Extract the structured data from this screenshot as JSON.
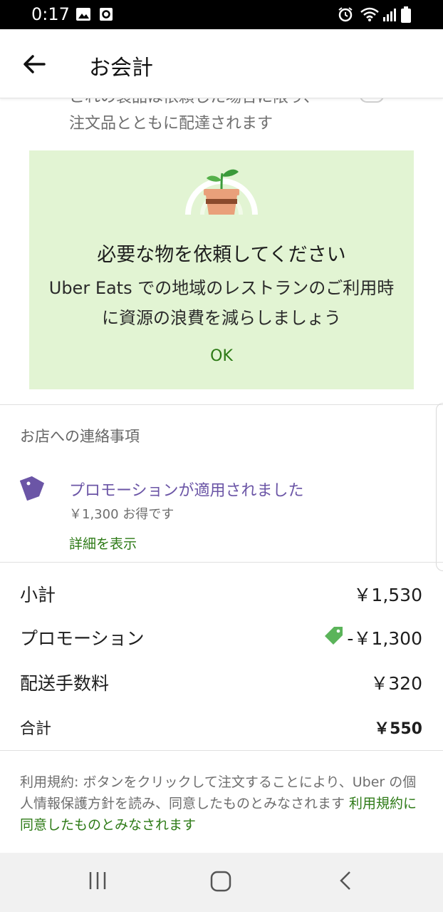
{
  "status_bar": {
    "time": "0:17",
    "icons": [
      "image-icon",
      "circle-app-icon",
      "alarm-icon",
      "wifi-icon",
      "signal-icon",
      "battery-icon"
    ]
  },
  "app_bar": {
    "title": "お会計",
    "back_icon": "arrow-left-icon"
  },
  "clipped_item": {
    "line1": "これの製品は依頼した場合に限り、",
    "line2": "注文品とともに配達されます"
  },
  "promo_card": {
    "title": "必要な物を依頼してください",
    "body": "Uber Eats での地域のレストランのご利用時に資源の浪費を減らしましょう",
    "ok_label": "OK",
    "background": "#e2f4d3"
  },
  "restaurant_notes": {
    "label": "お店への連絡事項"
  },
  "promotion": {
    "icon": "tag-icon",
    "applied_text": "プロモーションが適用されました",
    "saving_text": "￥1,300 お得です",
    "details_link": "詳細を表示"
  },
  "summary": {
    "subtotal_label": "小計",
    "subtotal_value": "￥1,530",
    "promotion_label": "プロモーション",
    "promotion_value": "-￥1,300",
    "delivery_label": "配送手数料",
    "delivery_value": "￥320",
    "total_label": "合計",
    "total_value": "￥550"
  },
  "terms": {
    "text": "利用規約: ボタンをクリックして注文することにより、Uber の個人情報保護方針を読み、同意したものとみなされます ",
    "link": "利用規約に同意したものとみなされます"
  },
  "nav_bar": {
    "buttons": [
      "recent-apps-icon",
      "home-icon",
      "back-icon"
    ]
  },
  "colors": {
    "accent_green": "#2d7a16",
    "promo_purple": "#6b55a6",
    "tag_green": "#5bb45a"
  }
}
